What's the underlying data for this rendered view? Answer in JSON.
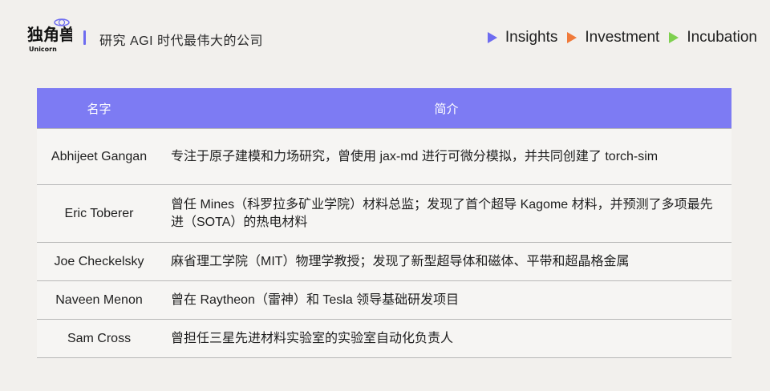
{
  "header": {
    "logo_text": "独角兽",
    "logo_sub": "Unicorn",
    "tagline": "研究 AGI 时代最伟大的公司",
    "nav": [
      {
        "label": "Insights",
        "color": "#6e6cf0",
        "icon": "triangle-right-icon"
      },
      {
        "label": "Investment",
        "color": "#f07a3a",
        "icon": "triangle-right-icon"
      },
      {
        "label": "Incubation",
        "color": "#7ed04f",
        "icon": "triangle-right-icon"
      }
    ]
  },
  "table": {
    "headers": {
      "name": "名字",
      "desc": "简介"
    },
    "rows": [
      {
        "name": "Abhijeet Gangan",
        "desc": "专注于原子建模和力场研究，曾使用 jax-md 进行可微分模拟，并共同创建了 torch-sim"
      },
      {
        "name": "Eric Toberer",
        "desc": "曾任 Mines（科罗拉多矿业学院）材料总监；发现了首个超导 Kagome 材料，并预测了多项最先进（SOTA）的热电材料"
      },
      {
        "name": "Joe Checkelsky",
        "desc": "麻省理工学院（MIT）物理学教授；发现了新型超导体和磁体、平带和超晶格金属"
      },
      {
        "name": "Naveen Menon",
        "desc": "曾在 Raytheon（雷神）和 Tesla 领导基础研发项目"
      },
      {
        "name": "Sam Cross",
        "desc": "曾担任三星先进材料实验室的实验室自动化负责人"
      }
    ]
  },
  "colors": {
    "accent": "#6e6cf0",
    "header_bg": "#7d7bf3",
    "page_bg": "#f2f0ed"
  }
}
